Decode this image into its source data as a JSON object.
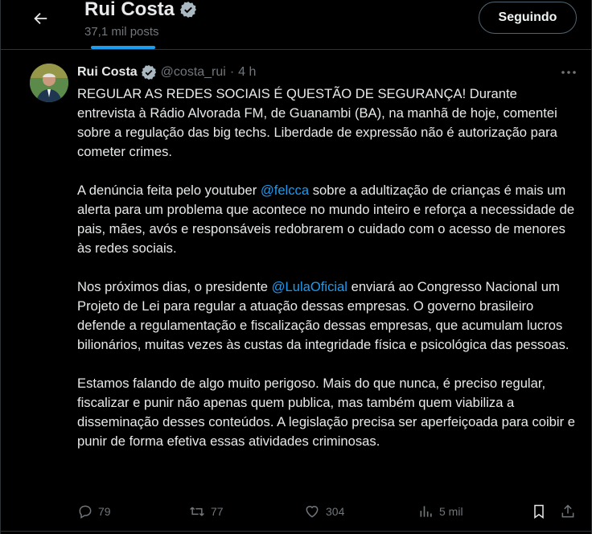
{
  "header": {
    "name": "Rui Costa",
    "post_count": "37,1 mil posts",
    "follow_label": "Seguindo"
  },
  "tweet": {
    "author": "Rui Costa",
    "handle": "@costa_rui",
    "separator": "·",
    "time": "4 h",
    "p1": "REGULAR AS REDES SOCIAIS É QUESTÃO DE SEGURANÇA! Durante entrevista à Rádio Alvorada FM, de Guanambi (BA), na manhã de hoje, comentei sobre a regulação das big techs. Liberdade de expressão não é autorização para cometer crimes.",
    "p2_before": "A denúncia feita pelo youtuber ",
    "p2_mention": "@felcca",
    "p2_after": " sobre a adultização de crianças é mais um alerta para um problema que acontece no mundo inteiro e reforça a necessidade de pais, mães, avós e responsáveis redobrarem o cuidado com o acesso de menores às redes sociais.",
    "p3_before": "Nos próximos dias, o presidente ",
    "p3_mention": "@LulaOficial",
    "p3_after": " enviará ao Congresso Nacional um Projeto de Lei para regular a atuação dessas empresas. O governo brasileiro defende a regulamentação e fiscalização dessas empresas, que acumulam lucros bilionários, muitas vezes às custas da integridade física e psicológica das pessoas.",
    "p4": "Estamos falando de algo muito perigoso. Mais do que nunca, é preciso regular, fiscalizar e punir não apenas quem publica, mas também quem viabiliza a disseminação desses conteúdos. A legislação precisa ser aperfeiçoada para coibir e punir de forma efetiva essas atividades criminosas."
  },
  "actions": {
    "replies": "79",
    "reposts": "77",
    "likes": "304",
    "views": "5 mil"
  },
  "colors": {
    "background": "#000000",
    "text": "#e7e9ea",
    "muted": "#71767b",
    "accent": "#1d9bf0",
    "border": "#2f3336"
  },
  "icons": {
    "back": "arrow-left-icon",
    "verified": "verified-badge-icon",
    "more": "more-dots-icon",
    "reply": "reply-icon",
    "repost": "repost-icon",
    "like": "heart-icon",
    "views": "views-icon",
    "bookmark": "bookmark-icon",
    "share": "share-icon"
  }
}
